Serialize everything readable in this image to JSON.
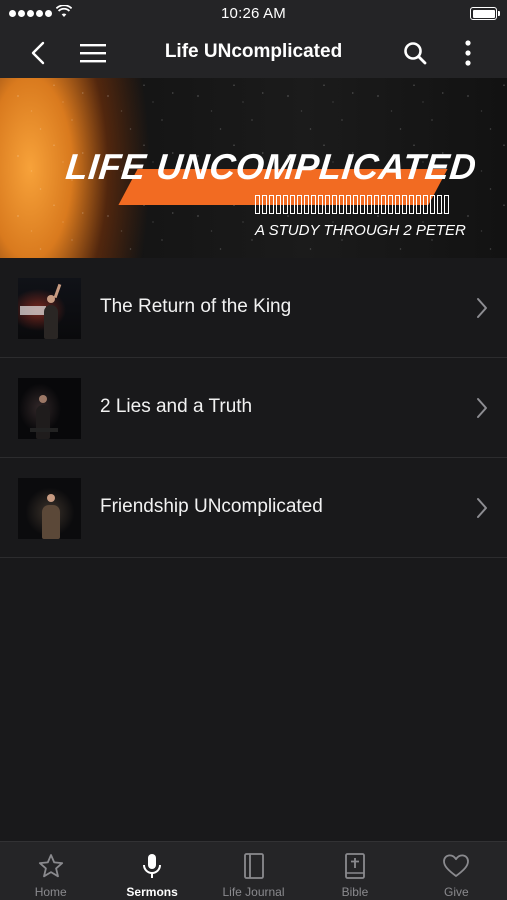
{
  "status_bar": {
    "time": "10:26 AM"
  },
  "nav": {
    "title": "Life UNcomplicated"
  },
  "banner": {
    "title": "LIFE UNCOMPLICATED",
    "subtitle": "A STUDY THROUGH 2 PETER"
  },
  "sermons": [
    {
      "title": "The Return of the King"
    },
    {
      "title": "2 Lies and a Truth"
    },
    {
      "title": "Friendship UNcomplicated"
    }
  ],
  "tabs": [
    {
      "label": "Home",
      "icon": "star-icon",
      "active": false
    },
    {
      "label": "Sermons",
      "icon": "microphone-icon",
      "active": true
    },
    {
      "label": "Life Journal",
      "icon": "journal-icon",
      "active": false
    },
    {
      "label": "Bible",
      "icon": "bible-icon",
      "active": false
    },
    {
      "label": "Give",
      "icon": "heart-icon",
      "active": false
    }
  ],
  "colors": {
    "background": "#19191b",
    "bar": "#242426",
    "accent_orange": "#f26b22",
    "inactive_tab": "#8a8a8e"
  }
}
